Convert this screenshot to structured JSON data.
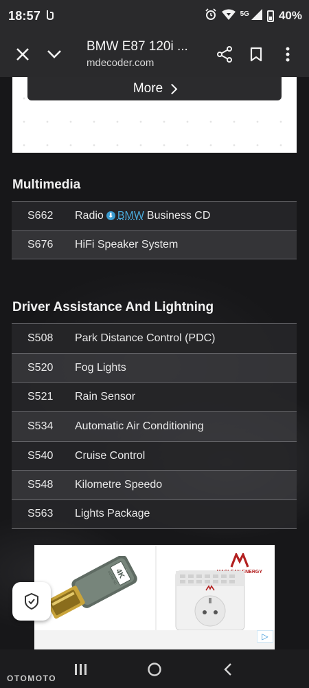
{
  "status_bar": {
    "time": "18:57",
    "network": "5G",
    "battery": "40%"
  },
  "toolbar": {
    "title": "BMW E87 120i ...",
    "url": "mdecoder.com"
  },
  "more_button": {
    "label": "More"
  },
  "multimedia": {
    "heading": "Multimedia",
    "rows": [
      {
        "code": "S662",
        "prefix": "Radio",
        "brand": "BMW",
        "suffix": "Business CD"
      },
      {
        "code": "S676",
        "desc": "HiFi Speaker System"
      }
    ]
  },
  "driver_assistance": {
    "heading": "Driver Assistance And Lightning",
    "rows": [
      {
        "code": "S508",
        "desc": "Park Distance Control (PDC)"
      },
      {
        "code": "S520",
        "desc": "Fog Lights"
      },
      {
        "code": "S521",
        "desc": "Rain Sensor"
      },
      {
        "code": "S534",
        "desc": "Automatic Air Conditioning"
      },
      {
        "code": "S540",
        "desc": "Cruise Control"
      },
      {
        "code": "S548",
        "desc": "Kilometre Speedo"
      },
      {
        "code": "S563",
        "desc": "Lights Package"
      }
    ]
  },
  "ad": {
    "badge": "4K",
    "badge_sub": "ULTRA HD",
    "brand": "MACLEAN ENERGY"
  },
  "watermark": "OTOMOTO"
}
